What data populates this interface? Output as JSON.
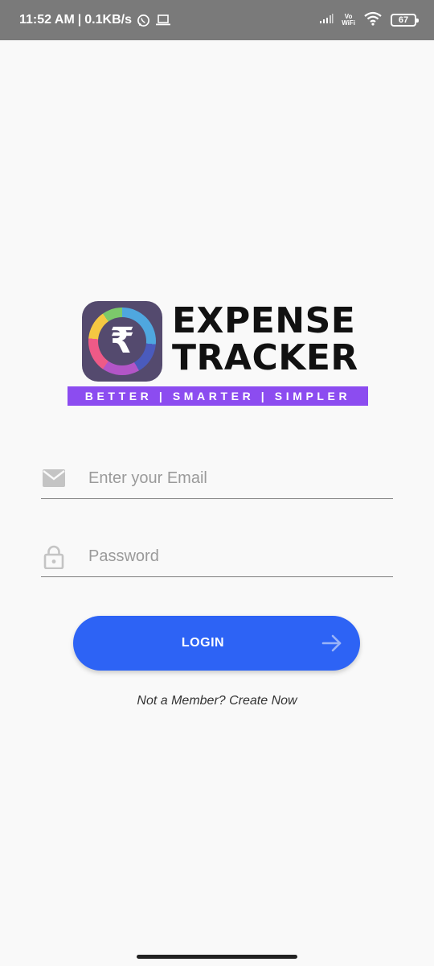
{
  "status_bar": {
    "time": "11:52 AM",
    "separator": "|",
    "net_speed": "0.1KB/s",
    "vowifi_top": "Vo",
    "vowifi_bottom": "WiFi",
    "battery": "67",
    "icons": [
      "whatsapp-icon",
      "laptop-icon",
      "signal-icon",
      "wifi-icon",
      "battery-icon"
    ]
  },
  "logo": {
    "rupee_symbol": "₹",
    "title_line1": "EXPENSE",
    "title_line2": "TRACKER",
    "tagline": "BETTER | SMARTER | SIMPLER"
  },
  "form": {
    "email_placeholder": "Enter your Email",
    "email_value": "",
    "password_placeholder": "Password",
    "password_value": ""
  },
  "login_button": {
    "label": "LOGIN"
  },
  "signup_link": "Not a Member? Create Now",
  "colors": {
    "status_bar": "#7a7a7a",
    "primary": "#2d63f5",
    "tagline_bg": "#8c4cf0",
    "background": "#f9f9f9"
  }
}
